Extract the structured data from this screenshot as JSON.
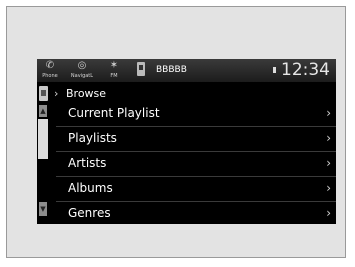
{
  "status_bar": {
    "phone_label": "Phone",
    "navigation_label": "NavigatL",
    "fm_label": "FM",
    "source_label": "BBBBB",
    "clock": "12:34"
  },
  "breadcrumb": {
    "label": "Browse"
  },
  "menu": {
    "items": [
      {
        "label": "Current Playlist"
      },
      {
        "label": "Playlists"
      },
      {
        "label": "Artists"
      },
      {
        "label": "Albums"
      },
      {
        "label": "Genres"
      }
    ]
  },
  "icons": {
    "phone": "phone-icon",
    "navigation": "navigation-icon",
    "fm": "radio-icon",
    "device": "media-device-icon",
    "chevron": "chevron-right-icon"
  },
  "colors": {
    "screen_background": "#000000",
    "text": "#ffffff",
    "frame": "#e3e3e3"
  }
}
